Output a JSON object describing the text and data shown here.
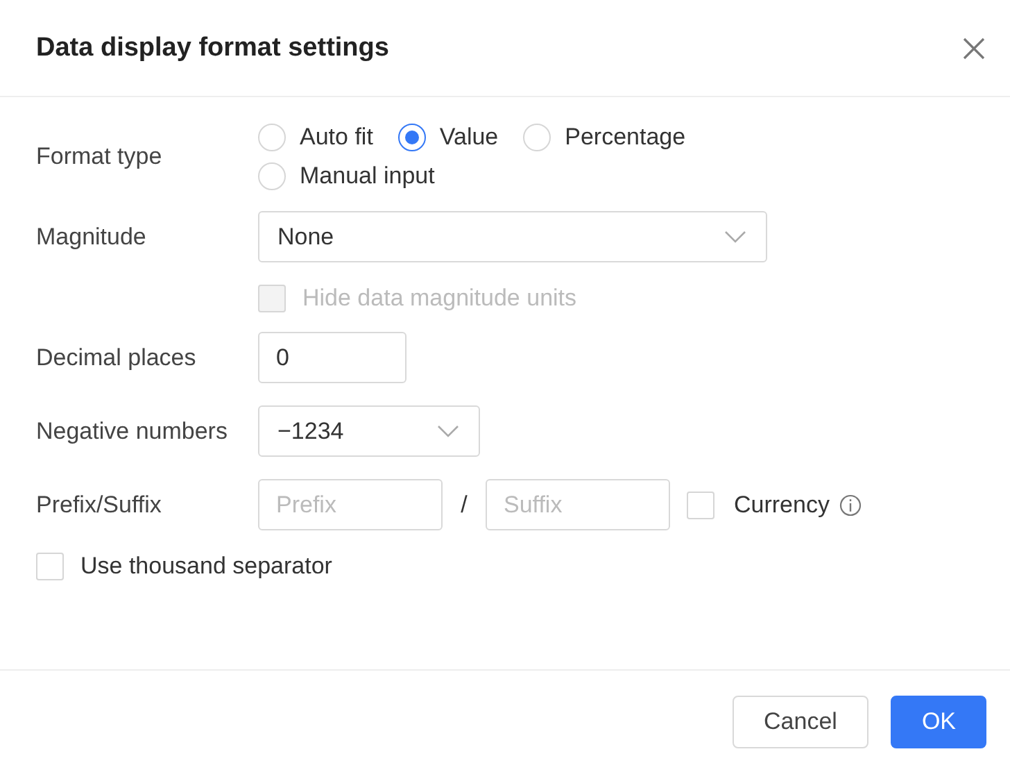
{
  "dialog": {
    "title": "Data display format settings"
  },
  "format_type": {
    "label": "Format type",
    "options": [
      {
        "label": "Auto fit",
        "selected": false
      },
      {
        "label": "Value",
        "selected": true
      },
      {
        "label": "Percentage",
        "selected": false
      },
      {
        "label": "Manual input",
        "selected": false
      }
    ]
  },
  "magnitude": {
    "label": "Magnitude",
    "value": "None"
  },
  "hide_units": {
    "label": "Hide data magnitude units",
    "checked": false,
    "disabled": true
  },
  "decimal_places": {
    "label": "Decimal places",
    "value": "0"
  },
  "negative_numbers": {
    "label": "Negative numbers",
    "value": "−1234"
  },
  "prefix_suffix": {
    "label": "Prefix/Suffix",
    "prefix_placeholder": "Prefix",
    "separator": "/",
    "suffix_placeholder": "Suffix"
  },
  "currency": {
    "label": "Currency",
    "checked": false
  },
  "thousand_separator": {
    "label": "Use thousand separator",
    "checked": false
  },
  "buttons": [
    {
      "label": "Cancel",
      "kind": "secondary"
    },
    {
      "label": "OK",
      "kind": "primary"
    }
  ]
}
